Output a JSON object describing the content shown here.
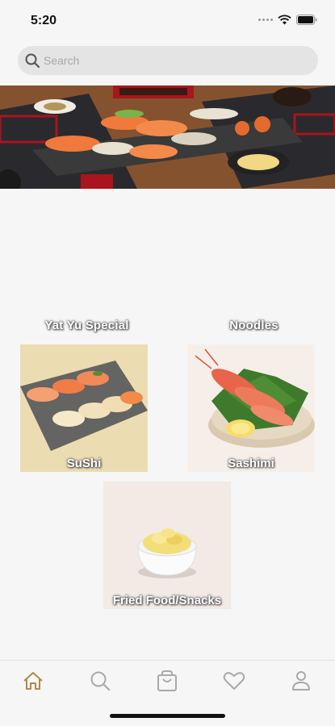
{
  "status_bar": {
    "time": "5:20"
  },
  "search": {
    "placeholder": "Search",
    "value": ""
  },
  "categories": {
    "yat_yu_special": "Yat Yu Special",
    "noodles": "Noodles",
    "sushi": "SuShi",
    "sashimi": "Sashimi",
    "fried_food": "Fried Food/Snacks"
  },
  "tab_bar": {
    "active": "home",
    "items": [
      "home-icon",
      "search-icon",
      "cart-icon",
      "heart-icon",
      "profile-icon"
    ]
  },
  "colors": {
    "accent": "#b08a4a",
    "inactive_icon": "#a9a9a9",
    "background": "#f6f6f6"
  }
}
